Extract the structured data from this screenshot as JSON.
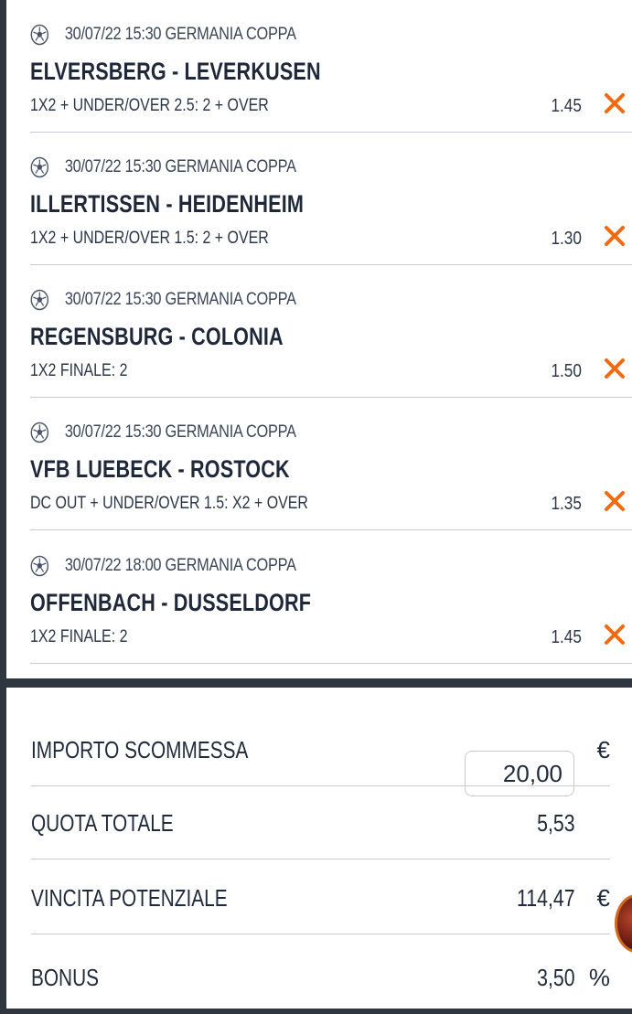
{
  "bets": [
    {
      "datetime": "30/07/22 15:30 GERMANIA COPPA",
      "teams": "ELVERSBERG - LEVERKUSEN",
      "market": "1X2 + UNDER/OVER 2.5: 2 + OVER",
      "odd": "1.45"
    },
    {
      "datetime": "30/07/22 15:30 GERMANIA COPPA",
      "teams": "ILLERTISSEN - HEIDENHEIM",
      "market": "1X2 + UNDER/OVER 1.5: 2 + OVER",
      "odd": "1.30"
    },
    {
      "datetime": "30/07/22 15:30 GERMANIA COPPA",
      "teams": "REGENSBURG - COLONIA",
      "market": "1X2 FINALE: 2",
      "odd": "1.50"
    },
    {
      "datetime": "30/07/22 15:30 GERMANIA COPPA",
      "teams": "VFB LUEBECK - ROSTOCK",
      "market": "DC OUT + UNDER/OVER 1.5: X2 + OVER",
      "odd": "1.35"
    },
    {
      "datetime": "30/07/22 18:00 GERMANIA COPPA",
      "teams": "OFFENBACH - DUSSELDORF",
      "market": "1X2 FINALE: 2",
      "odd": "1.45"
    }
  ],
  "icons": {
    "sport": "soccer-ball-icon",
    "remove": "close-icon"
  },
  "summary": {
    "stake_label": "IMPORTO SCOMMESSA",
    "stake_value": "20,00",
    "stake_currency": "€",
    "total_odds_label": "QUOTA TOTALE",
    "total_odds_value": "5,53",
    "potential_win_label": "VINCITA POTENZIALE",
    "potential_win_value": "114,47",
    "potential_win_currency": "€",
    "bonus_label": "BONUS",
    "bonus_value": "3,50",
    "bonus_unit": "%"
  },
  "colors": {
    "accent": "#f26a10",
    "background": "#2f3640",
    "text": "#1f2a3a",
    "divider": "#c8ccd2"
  }
}
